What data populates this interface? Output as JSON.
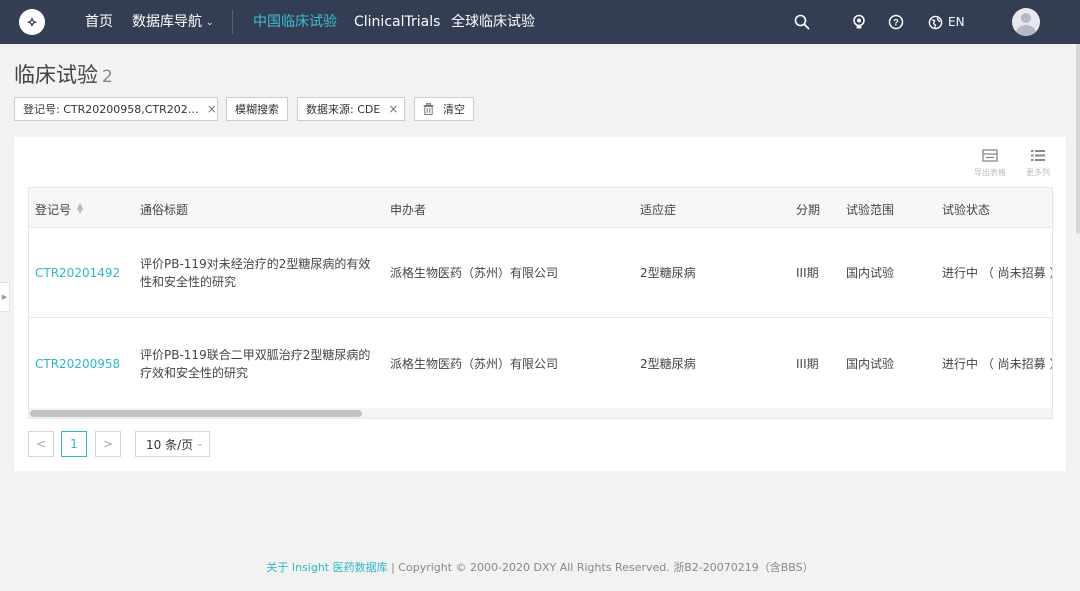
{
  "nav": {
    "items": {
      "home": "首页",
      "db_nav": "数据库导航",
      "cn_trials": "中国临床试验",
      "clinical_trials": "ClinicalTrials",
      "global_trials": "全球临床试验"
    },
    "lang": "EN",
    "accent_color": "#3dbfd1",
    "bg_color": "#333e55"
  },
  "page": {
    "title": "临床试验",
    "count": "2"
  },
  "filters": {
    "reg_no": "登记号: CTR20200958,CTR202…",
    "fuzzy": "模糊搜索",
    "source": "数据来源: CDE",
    "clear": "清空"
  },
  "tools": {
    "export": "导出表格",
    "more_cols": "更多列"
  },
  "table": {
    "headers": {
      "reg_no": "登记号",
      "title": "通俗标题",
      "sponsor": "申办者",
      "indication": "适应症",
      "phase": "分期",
      "scope": "试验范围",
      "status": "试验状态"
    },
    "rows": [
      {
        "reg_no": "CTR20201492",
        "title": "评价PB-119对未经治疗的2型糖尿病的有效性和安全性的研究",
        "sponsor": "派格生物医药（苏州）有限公司",
        "indication": "2型糖尿病",
        "phase": "III期",
        "scope": "国内试验",
        "status": "进行中 （ 尚未招募 ）"
      },
      {
        "reg_no": "CTR20200958",
        "title": "评价PB-119联合二甲双胍治疗2型糖尿病的疗效和安全性的研究",
        "sponsor": "派格生物医药（苏州）有限公司",
        "indication": "2型糖尿病",
        "phase": "III期",
        "scope": "国内试验",
        "status": "进行中 （ 尚未招募 ）"
      }
    ]
  },
  "pager": {
    "prev": "<",
    "current": "1",
    "next": ">",
    "page_size": "10 条/页"
  },
  "footer": {
    "link": "关于 Insight 医药数据库",
    "copyright": " | Copyright © 2000-2020 DXY All Rights Reserved. 浙B2-20070219（含BBS）"
  }
}
